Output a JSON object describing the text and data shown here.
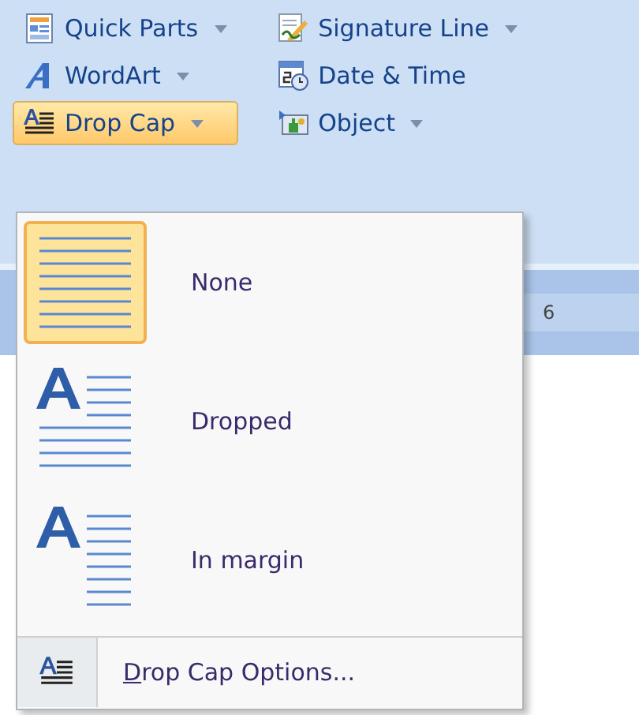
{
  "ribbon": {
    "columns": [
      [
        {
          "label": "Quick Parts",
          "dropdown": true,
          "active": false
        },
        {
          "label": "WordArt",
          "dropdown": true,
          "active": false
        },
        {
          "label": "Drop Cap",
          "dropdown": true,
          "active": true
        }
      ],
      [
        {
          "label": "Signature Line",
          "dropdown": true,
          "active": false
        },
        {
          "label": "Date & Time",
          "dropdown": false,
          "active": false
        },
        {
          "label": "Object",
          "dropdown": true,
          "active": false
        }
      ]
    ]
  },
  "ruler": {
    "label": "6"
  },
  "menu": {
    "items": [
      {
        "label": "None",
        "kind": "none",
        "selected": true
      },
      {
        "label": "Dropped",
        "kind": "dropped",
        "selected": false
      },
      {
        "label": "In margin",
        "kind": "margin",
        "selected": false
      }
    ],
    "options": {
      "label": "Drop Cap Options...",
      "access_key_underlined": true
    }
  }
}
